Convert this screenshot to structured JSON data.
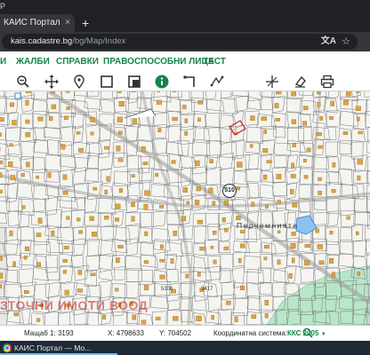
{
  "window": {
    "title_fragment": "P"
  },
  "tab": {
    "title": "КАИС Портал",
    "close": "×",
    "new_tab": "+"
  },
  "address_bar": {
    "host": "kais.cadastre.bg",
    "path": "/bg/Map/Index"
  },
  "site_nav": {
    "items": [
      "И",
      "ЖАЛБИ",
      "СПРАВКИ",
      "ПРАВОСПОСОБНИ ЛИЦА",
      "ТЕСТ"
    ]
  },
  "toolbar": {
    "tools": [
      "zoom-out-icon",
      "pan-icon",
      "location-pin-icon",
      "select-rectangle-icon",
      "select-area-icon",
      "info-icon",
      "measure-angle-icon",
      "draw-line-icon",
      "cut-icon",
      "eraser-icon",
      "print-icon"
    ],
    "active_tool": "info-icon",
    "accent": "#14844a"
  },
  "map": {
    "locality_label": "Перчемнията",
    "road_number": "510",
    "overlay_text": "ЗТОЧНИ ИМОТИ ВООД",
    "parcel_number_1": "5106",
    "parcel_number_2": "3417",
    "colors": {
      "building": "#e2a23a",
      "parcel_line": "#777777",
      "forest": "#b8e6c8",
      "highlight": "#3b8ede"
    }
  },
  "status_bar": {
    "scale_label": "Мащаб 1:",
    "scale_value": "3193",
    "x_label": "X:",
    "x_value": "4798633",
    "y_label": "Y:",
    "y_value": "704502",
    "crs_label": "Координатна система:",
    "crs_value": "ККС 2005"
  },
  "taskbar": {
    "label": "КАИС Портал — Мо..."
  }
}
